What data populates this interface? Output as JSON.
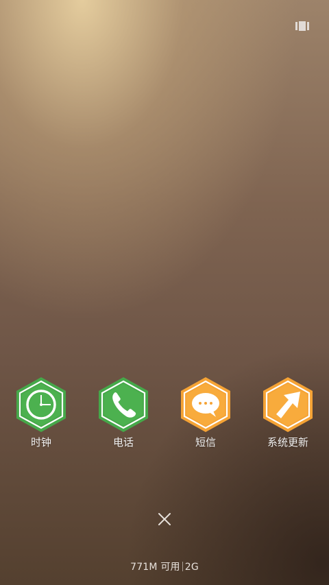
{
  "colors": {
    "green_outer": "#46a84a",
    "green_inner": "#4cb14f",
    "orange_outer": "#f5a335",
    "orange_inner": "#f8ab3c",
    "ring": "#ffffff"
  },
  "apps": [
    {
      "id": "clock",
      "label": "时钟",
      "icon": "clock-icon",
      "color": "green"
    },
    {
      "id": "phone",
      "label": "电话",
      "icon": "phone-icon",
      "color": "green"
    },
    {
      "id": "sms",
      "label": "短信",
      "icon": "message-icon",
      "color": "orange"
    },
    {
      "id": "update",
      "label": "系统更新",
      "icon": "update-arrow-icon",
      "color": "orange"
    }
  ],
  "status": {
    "memory": "771M 可用",
    "total": "2G"
  },
  "controls": {
    "close": "close-icon",
    "overview": "overview-icon"
  }
}
